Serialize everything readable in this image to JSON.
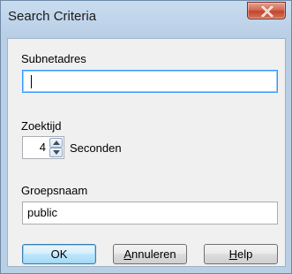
{
  "dialog": {
    "title": "Search Criteria"
  },
  "fields": {
    "subnet_label": "Subnetadres",
    "subnet_value": "",
    "timeout_label": "Zoektijd",
    "timeout_value": "4",
    "timeout_unit": "Seconden",
    "group_label": "Groepsnaam",
    "group_value": "public"
  },
  "buttons": {
    "ok_label": "OK",
    "cancel_first": "A",
    "cancel_rest": "nnuleren",
    "help_first": "H",
    "help_rest": "elp"
  },
  "icons": {
    "close": "close-icon",
    "spin_up": "arrow-up-icon",
    "spin_down": "arrow-down-icon"
  },
  "colors": {
    "close_button": "#c94a33",
    "focus_border": "#3399ff",
    "default_button": "#bee6fd"
  }
}
